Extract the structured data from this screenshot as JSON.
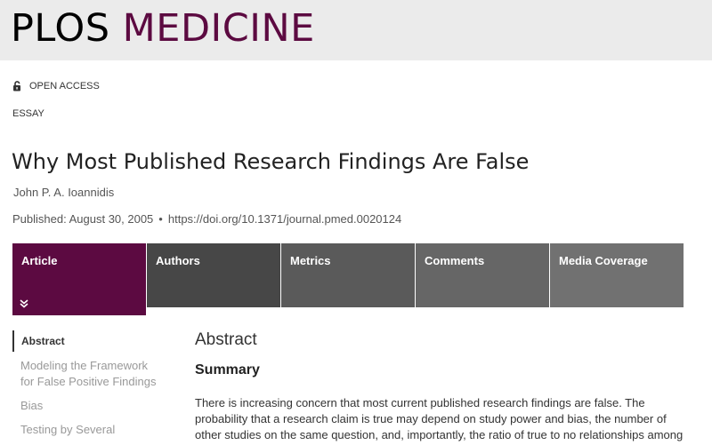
{
  "masthead": {
    "logo_part1": "PLOS",
    "logo_part2": "MEDICINE"
  },
  "article_meta": {
    "access_label": "OPEN ACCESS",
    "access_icon": "unlocked-padlock-icon",
    "article_type": "ESSAY",
    "title": "Why Most Published Research Findings Are False",
    "author": "John P. A. Ioannidis",
    "published": "Published: August 30, 2005",
    "separator": "•",
    "doi": "https://doi.org/10.1371/journal.pmed.0020124"
  },
  "tabs": [
    {
      "label": "Article"
    },
    {
      "label": "Authors"
    },
    {
      "label": "Metrics"
    },
    {
      "label": "Comments"
    },
    {
      "label": "Media Coverage"
    }
  ],
  "toc": [
    {
      "label": "Abstract"
    },
    {
      "label": "Modeling the Framework for False Positive Findings"
    },
    {
      "label": "Bias"
    },
    {
      "label": "Testing by Several"
    }
  ],
  "content": {
    "section_heading": "Abstract",
    "subheading": "Summary",
    "paragraph": "There is increasing concern that most current published research findings are false. The probability that a research claim is true may depend on study power and bias, the number of other studies on the same question, and, importantly, the ratio of true to no relationships among"
  },
  "colors": {
    "brand": "#5c0a41",
    "masthead_bg": "#ebebeb",
    "tab_active": "#5c0a41"
  }
}
